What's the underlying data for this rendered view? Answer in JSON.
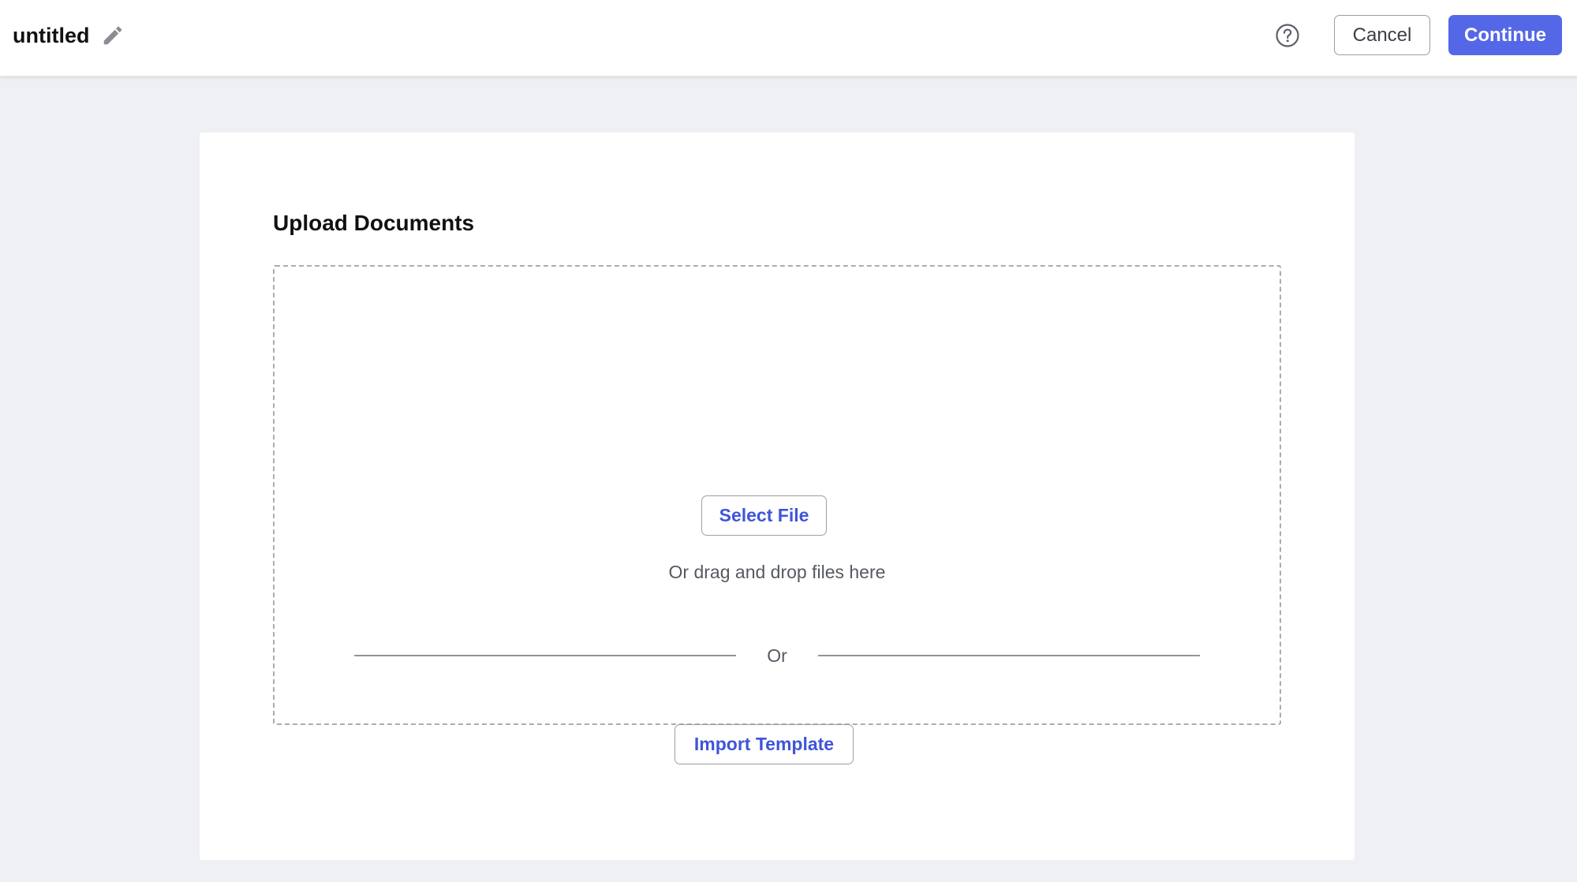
{
  "header": {
    "doc_title": "untitled",
    "edit_icon": "pencil-icon",
    "help_icon": "help-circle-icon",
    "cancel_label": "Cancel",
    "continue_label": "Continue"
  },
  "upload": {
    "title": "Upload Documents",
    "select_file_label": "Select File",
    "drag_drop_text": "Or drag and drop files here",
    "or_text": "Or",
    "import_template_label": "Import Template"
  },
  "colors": {
    "accent": "#5468e7",
    "link": "#3f55d8",
    "background": "#eef0f3"
  }
}
